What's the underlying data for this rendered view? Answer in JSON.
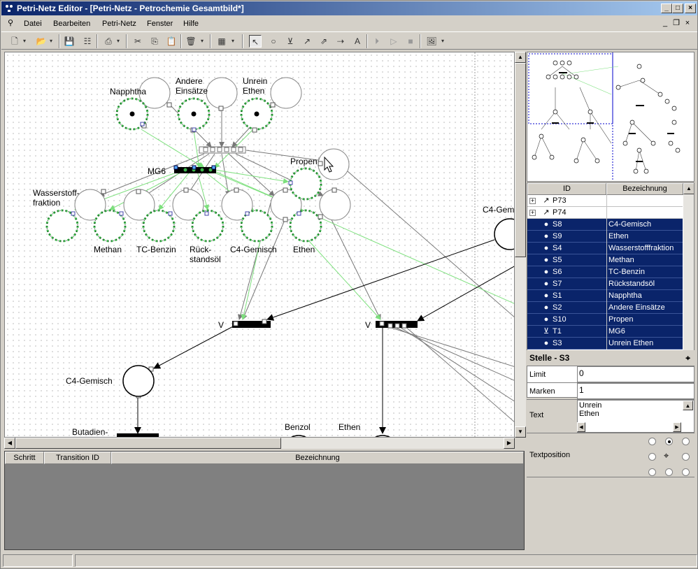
{
  "window": {
    "title": "Petri-Netz Editor - [Petri-Netz - Petrochemie Gesamtbild*]"
  },
  "menu": {
    "items": [
      "Datei",
      "Bearbeiten",
      "Petri-Netz",
      "Fenster",
      "Hilfe"
    ]
  },
  "canvas": {
    "labels": {
      "napphtha": "Napphtha",
      "andere1": "Andere",
      "andere2": "Einsätze",
      "unrein1": "Unrein",
      "unrein2": "Ethen",
      "propen": "Propen",
      "mg6": "MG6",
      "wasser1": "Wasserstoff-",
      "wasser2": "fraktion",
      "methan": "Methan",
      "tcbenzin": "TC-Benzin",
      "rueck1": "Rück-",
      "rueck2": "standsöl",
      "c4gemisch": "C4-Gemisch",
      "ethen": "Ethen",
      "c4gem_right": "C4-Gem",
      "v1": "V",
      "v2": "V",
      "c4gemisch2": "C4-Gemisch",
      "butadien": "Butadien-",
      "benzol": "Benzol",
      "ethen2": "Ethen"
    }
  },
  "table": {
    "headers": {
      "id": "ID",
      "bezeichnung": "Bezeichnung"
    },
    "rows": [
      {
        "id": "P73",
        "bez": "",
        "selected": false,
        "type": "transition-group"
      },
      {
        "id": "P74",
        "bez": "",
        "selected": false,
        "type": "transition-group"
      },
      {
        "id": "S8",
        "bez": "C4-Gemisch",
        "selected": true,
        "type": "place"
      },
      {
        "id": "S9",
        "bez": "Ethen",
        "selected": true,
        "type": "place"
      },
      {
        "id": "S4",
        "bez": "Wasserstofffraktion",
        "selected": true,
        "type": "place"
      },
      {
        "id": "S5",
        "bez": "Methan",
        "selected": true,
        "type": "place"
      },
      {
        "id": "S6",
        "bez": "TC-Benzin",
        "selected": true,
        "type": "place"
      },
      {
        "id": "S7",
        "bez": "Rückstandsöl",
        "selected": true,
        "type": "place"
      },
      {
        "id": "S1",
        "bez": "Napphtha",
        "selected": true,
        "type": "place"
      },
      {
        "id": "S2",
        "bez": "Andere Einsätze",
        "selected": true,
        "type": "place"
      },
      {
        "id": "S10",
        "bez": "Propen",
        "selected": true,
        "type": "place"
      },
      {
        "id": "T1",
        "bez": "MG6",
        "selected": true,
        "type": "transition"
      },
      {
        "id": "S3",
        "bez": "Unrein Ethen",
        "selected": true,
        "type": "place"
      }
    ]
  },
  "properties": {
    "title": "Stelle - S3",
    "limit_label": "Limit",
    "limit_value": "0",
    "marken_label": "Marken",
    "marken_value": "1",
    "text_label": "Text",
    "text_line1": "Unrein",
    "text_line2": "Ethen",
    "textpos_label": "Textposition"
  },
  "bottom": {
    "headers": {
      "schritt": "Schritt",
      "transition": "Transition ID",
      "bezeichnung": "Bezeichnung"
    }
  }
}
